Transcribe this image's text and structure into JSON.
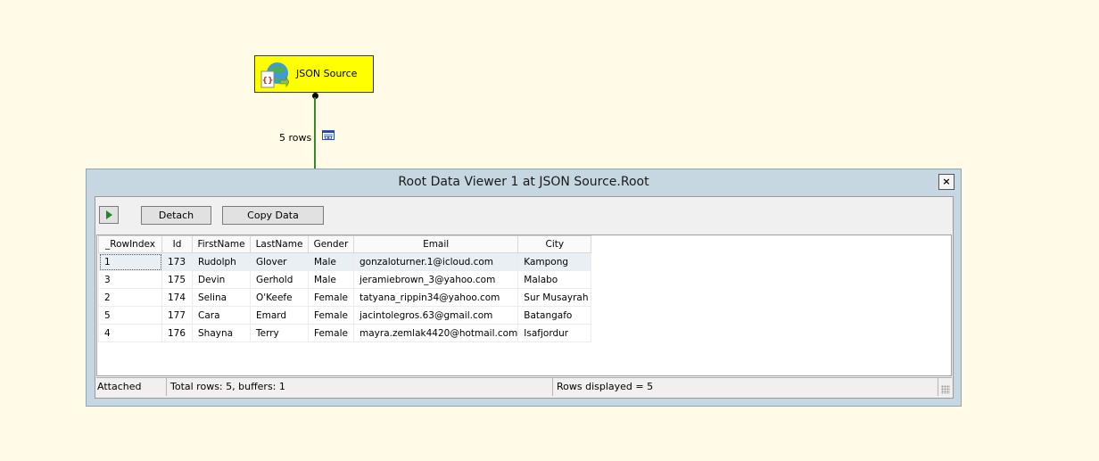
{
  "node": {
    "label": "JSON Source",
    "icon": "json-source-icon"
  },
  "connector": {
    "rows_label": "5 rows",
    "viewer_icon": "data-viewer-icon"
  },
  "viewer": {
    "title": "Root Data Viewer 1 at JSON Source.Root",
    "close_label": "×",
    "toolbar": {
      "detach_label": "Detach",
      "copy_label": "Copy Data"
    },
    "columns": [
      "_RowIndex",
      "Id",
      "FirstName",
      "LastName",
      "Gender",
      "Email",
      "City"
    ],
    "rows": [
      [
        "1",
        "173",
        "Rudolph",
        "Glover",
        "Male",
        "gonzaloturner.1@icloud.com",
        "Kampong"
      ],
      [
        "3",
        "175",
        "Devin",
        "Gerhold",
        "Male",
        "jeramiebrown_3@yahoo.com",
        "Malabo"
      ],
      [
        "2",
        "174",
        "Selina",
        "O'Keefe",
        "Female",
        "tatyana_rippin34@yahoo.com",
        "Sur Musayrah"
      ],
      [
        "5",
        "177",
        "Cara",
        "Emard",
        "Female",
        "jacintolegros.63@gmail.com",
        "Batangafo"
      ],
      [
        "4",
        "176",
        "Shayna",
        "Terry",
        "Female",
        "mayra.zemlak4420@hotmail.com",
        "Isafjordur"
      ]
    ],
    "status": {
      "state": "Attached",
      "totals": "Total rows: 5, buffers: 1",
      "displayed": "Rows displayed = 5"
    }
  },
  "colors": {
    "canvas": "#fffbe7",
    "node": "#ffff00",
    "connector": "#2e8b2e",
    "viewer_frame": "#c6d7e1",
    "selected_row": "#e8eff5"
  }
}
